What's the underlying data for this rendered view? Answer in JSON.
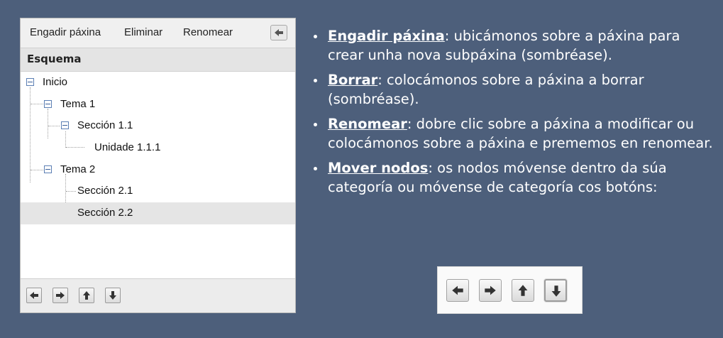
{
  "toolbar": {
    "add_page": "Engadir páxina",
    "delete": "Eliminar",
    "rename": "Renomear",
    "collapse_icon": "arrow-left-icon"
  },
  "outline": {
    "header": "Esquema",
    "nodes": [
      {
        "label": "Inicio",
        "level": 0,
        "expanded": true
      },
      {
        "label": "Tema 1",
        "level": 1,
        "expanded": true
      },
      {
        "label": "Sección 1.1",
        "level": 2,
        "expanded": true
      },
      {
        "label": "Unidade 1.1.1",
        "level": 3
      },
      {
        "label": "Tema 2",
        "level": 1,
        "expanded": true
      },
      {
        "label": "Sección 2.1",
        "level": 2
      },
      {
        "label": "Sección 2.2",
        "level": 2,
        "selected": true
      }
    ]
  },
  "nav_buttons": [
    "arrow-left-icon",
    "arrow-right-icon",
    "arrow-up-icon",
    "arrow-down-icon"
  ],
  "help": [
    {
      "term": "Engadir páxina",
      "text": ": ubicámonos sobre a páxina para crear unha nova subpáxina (sombréase)."
    },
    {
      "term": "Borrar",
      "text": ": colocámonos sobre a páxina a borrar (sombréase)."
    },
    {
      "term": "Renomear",
      "text": ": dobre clic sobre a páxina a modificar ou colocámonos sobre a páxina e prememos en renomear."
    },
    {
      "term": "Mover nodos",
      "text": ": os nodos móvense dentro da súa categoría ou móvense de categoría cos botóns:"
    }
  ],
  "colors": {
    "background": "#4d5f7b",
    "toggle_border": "#5b7fb4",
    "selected_row": "#e5e5e5"
  }
}
